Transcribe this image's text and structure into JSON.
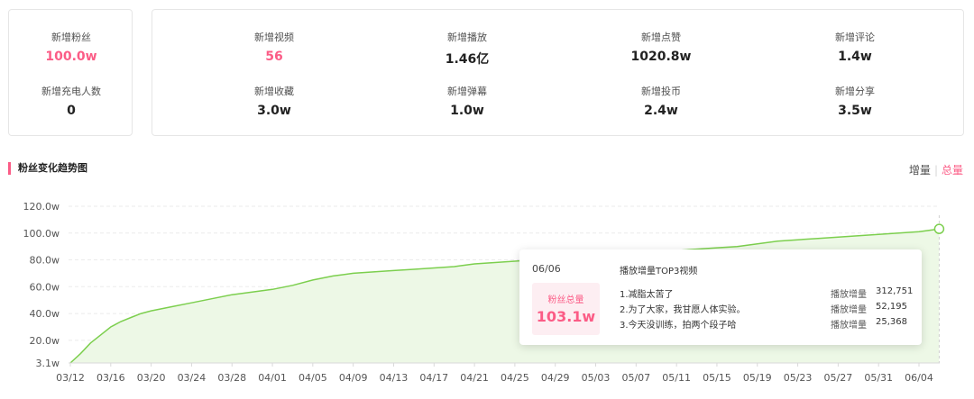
{
  "stats_left": [
    {
      "label": "新增粉丝",
      "value": "100.0w",
      "highlight": true
    },
    {
      "label": "新增充电人数",
      "value": "0",
      "highlight": false
    }
  ],
  "stats_right": [
    {
      "label": "新增视频",
      "value": "56",
      "highlight": true
    },
    {
      "label": "新增播放",
      "value": "1.46亿",
      "highlight": false
    },
    {
      "label": "新增点赞",
      "value": "1020.8w",
      "highlight": false
    },
    {
      "label": "新增评论",
      "value": "1.4w",
      "highlight": false
    },
    {
      "label": "新增收藏",
      "value": "3.0w",
      "highlight": false
    },
    {
      "label": "新增弹幕",
      "value": "1.0w",
      "highlight": false
    },
    {
      "label": "新增投币",
      "value": "2.4w",
      "highlight": false
    },
    {
      "label": "新增分享",
      "value": "3.5w",
      "highlight": false
    }
  ],
  "section_title": "粉丝变化趋势图",
  "toggle": {
    "increment": "增量",
    "separator": "|",
    "total": "总量",
    "active": "total"
  },
  "colors": {
    "accent": "#fb5c86",
    "line": "#7ccf4e",
    "fill": "#edf8e6"
  },
  "chart_data": {
    "type": "area",
    "title": "",
    "xlabel": "",
    "ylabel": "",
    "ylim": [
      3.1,
      120
    ],
    "y_ticks": [
      "120.0w",
      "100.0w",
      "80.0w",
      "60.0w",
      "40.0w",
      "20.0w",
      "3.1w"
    ],
    "y_tick_values": [
      120,
      100,
      80,
      60,
      40,
      20,
      3.1
    ],
    "x_tick_labels": [
      "03/12",
      "03/16",
      "03/20",
      "03/24",
      "03/28",
      "04/01",
      "04/05",
      "04/09",
      "04/13",
      "04/17",
      "04/21",
      "04/25",
      "04/29",
      "05/03",
      "05/07",
      "05/11",
      "05/15",
      "05/19",
      "05/23",
      "05/27",
      "05/31",
      "06/04"
    ],
    "grid": true,
    "series": [
      {
        "x": [
          "03/12",
          "03/13",
          "03/14",
          "03/15",
          "03/16",
          "03/17",
          "03/18",
          "03/19",
          "03/20",
          "03/22",
          "03/24",
          "03/26",
          "03/28",
          "03/30",
          "04/01",
          "04/03",
          "04/05",
          "04/07",
          "04/09",
          "04/11",
          "04/13",
          "04/15",
          "04/17",
          "04/19",
          "04/21",
          "04/23",
          "04/25",
          "04/27",
          "04/29",
          "05/01",
          "05/03",
          "05/05",
          "05/07",
          "05/09",
          "05/11",
          "05/13",
          "05/15",
          "05/17",
          "05/19",
          "05/21",
          "05/23",
          "05/25",
          "05/27",
          "05/29",
          "05/31",
          "06/02",
          "06/04",
          "06/06"
        ],
        "values": [
          3.1,
          10,
          18,
          24,
          30,
          34,
          37,
          40,
          42,
          45,
          48,
          51,
          54,
          56,
          58,
          61,
          65,
          68,
          70,
          71,
          72,
          73,
          74,
          75,
          77,
          78,
          79,
          80,
          81,
          82,
          83,
          84,
          85,
          86,
          87,
          88,
          89,
          90,
          92,
          94,
          95,
          96,
          97,
          98,
          99,
          100,
          101,
          103.1
        ],
        "unit": "w"
      }
    ],
    "tooltip": {
      "date": "06/06",
      "total_label": "粉丝总量",
      "total_value": "103.1w",
      "top_header": "播放增量TOP3视频",
      "videos": [
        {
          "title": "1.减脂太苦了",
          "label": "播放增量",
          "value": "312,751"
        },
        {
          "title": "2.为了大家，我甘愿人体实验。",
          "label": "播放增量",
          "value": "52,195"
        },
        {
          "title": "3.今天没训练，拍两个段子哈",
          "label": "播放增量",
          "value": "25,368"
        }
      ]
    }
  }
}
